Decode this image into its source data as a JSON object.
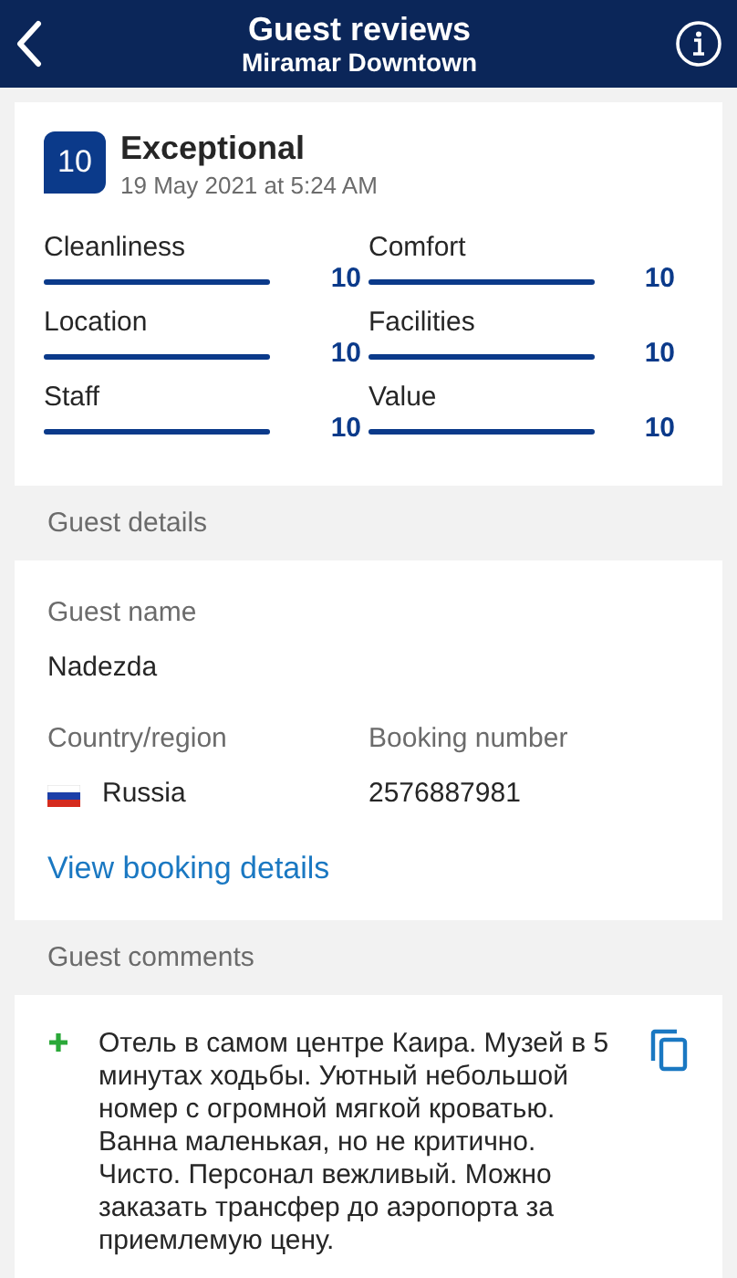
{
  "header": {
    "title": "Guest reviews",
    "subtitle": "Miramar Downtown"
  },
  "review": {
    "score": "10",
    "verdict": "Exceptional",
    "date": "19 May 2021 at 5:24 AM",
    "ratings": [
      {
        "label": "Cleanliness",
        "score": "10",
        "level": 1
      },
      {
        "label": "Comfort",
        "score": "10",
        "level": 1
      },
      {
        "label": "Location",
        "score": "10",
        "level": 1
      },
      {
        "label": "Facilities",
        "score": "10",
        "level": 1
      },
      {
        "label": "Staff",
        "score": "10",
        "level": 1
      },
      {
        "label": "Value",
        "score": "10",
        "level": 1
      }
    ]
  },
  "guest_details": {
    "heading": "Guest details",
    "name_label": "Guest name",
    "name": "Nadezda",
    "country_label": "Country/region",
    "country": "Russia",
    "booking_label": "Booking number",
    "booking_number": "2576887981",
    "link": "View booking details"
  },
  "guest_comments": {
    "heading": "Guest comments",
    "comments": [
      {
        "kind": "positive",
        "text": "Отель в самом центре Каира. Музей в 5 минутах ходьбы. Уютный небольшой номер с огромной мягкой кроватью. Ванна маленькая, но не критично. Чисто. Персонал вежливый. Можно заказать трансфер до аэропорта за приемлемую цену."
      }
    ]
  }
}
